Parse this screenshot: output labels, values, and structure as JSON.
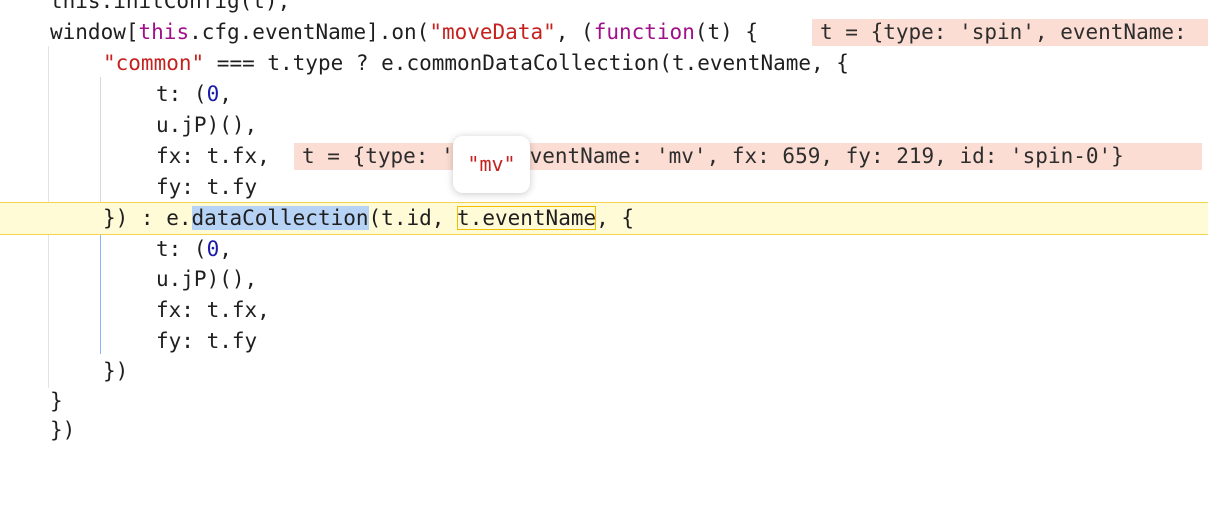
{
  "code": {
    "line_cut": "this.initConfig(t);",
    "line1": {
      "p1": "window[",
      "kw_this": "this",
      "p2": ".cfg.eventName].on(",
      "str": "\"moveData\"",
      "p3": ", (",
      "kw_function": "function",
      "p4": "(t) {"
    },
    "line2": {
      "str": "\"common\"",
      "p1": " === t.type ? e.commonDataCollection(t.eventName, {"
    },
    "line3": {
      "p1": "t: (",
      "num": "0",
      "p2": ","
    },
    "line4": "u.jP)(),",
    "line5": "fx: t.fx,",
    "line6": "fy: t.fy",
    "line7": {
      "p1": "}) : e.",
      "selected": "dataCollection",
      "p2": "(t.id, ",
      "outlined": "t.eventName",
      "p3": ", {"
    },
    "line8": {
      "p1": "t: (",
      "num": "0",
      "p2": ","
    },
    "line9": "u.jP)(),",
    "line10": "fx: t.fx,",
    "line11": "fy: t.fy",
    "line12": "})",
    "line13": "}",
    "line14": "})"
  },
  "inline_values": {
    "line1": "t = {type: 'spin', eventName:",
    "line5": "t = {type: 'mv', eventName: 'mv', fx: 659, fy: 219, id: 'spin-0'}"
  },
  "hover_tooltip": {
    "value": "\"mv\""
  },
  "colors": {
    "keyword": "#a1108a",
    "string": "#c5221f",
    "number": "#1a1aa6",
    "paused_line_bg": "#fffbd6",
    "selection": "#b6d2f5",
    "inline_value_bg": "#fbddd3"
  }
}
